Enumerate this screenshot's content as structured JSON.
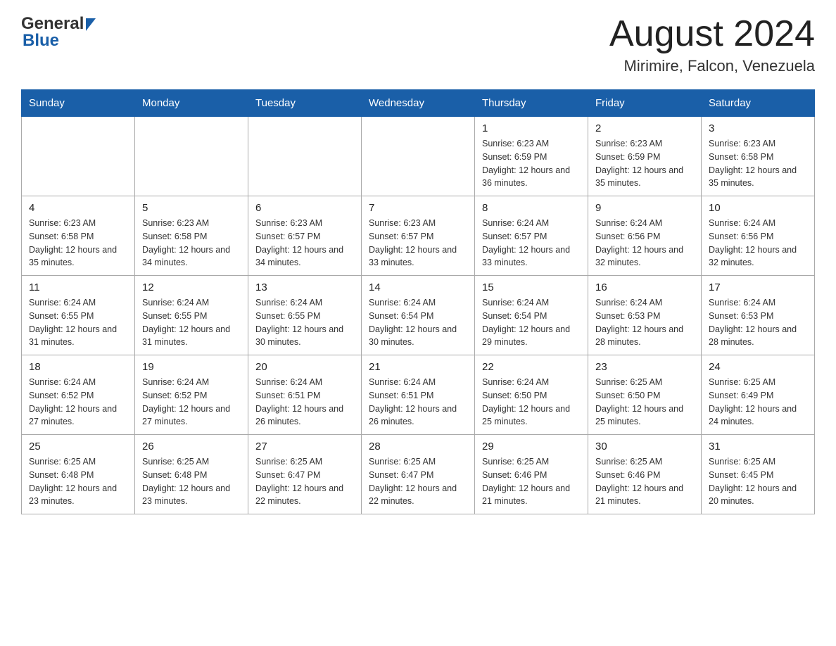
{
  "header": {
    "logo_general": "General",
    "logo_blue": "Blue",
    "title": "August 2024",
    "subtitle": "Mirimire, Falcon, Venezuela"
  },
  "calendar": {
    "days_of_week": [
      "Sunday",
      "Monday",
      "Tuesday",
      "Wednesday",
      "Thursday",
      "Friday",
      "Saturday"
    ],
    "weeks": [
      [
        {
          "day": "",
          "info": ""
        },
        {
          "day": "",
          "info": ""
        },
        {
          "day": "",
          "info": ""
        },
        {
          "day": "",
          "info": ""
        },
        {
          "day": "1",
          "info": "Sunrise: 6:23 AM\nSunset: 6:59 PM\nDaylight: 12 hours\nand 36 minutes."
        },
        {
          "day": "2",
          "info": "Sunrise: 6:23 AM\nSunset: 6:59 PM\nDaylight: 12 hours\nand 35 minutes."
        },
        {
          "day": "3",
          "info": "Sunrise: 6:23 AM\nSunset: 6:58 PM\nDaylight: 12 hours\nand 35 minutes."
        }
      ],
      [
        {
          "day": "4",
          "info": "Sunrise: 6:23 AM\nSunset: 6:58 PM\nDaylight: 12 hours\nand 35 minutes."
        },
        {
          "day": "5",
          "info": "Sunrise: 6:23 AM\nSunset: 6:58 PM\nDaylight: 12 hours\nand 34 minutes."
        },
        {
          "day": "6",
          "info": "Sunrise: 6:23 AM\nSunset: 6:57 PM\nDaylight: 12 hours\nand 34 minutes."
        },
        {
          "day": "7",
          "info": "Sunrise: 6:23 AM\nSunset: 6:57 PM\nDaylight: 12 hours\nand 33 minutes."
        },
        {
          "day": "8",
          "info": "Sunrise: 6:24 AM\nSunset: 6:57 PM\nDaylight: 12 hours\nand 33 minutes."
        },
        {
          "day": "9",
          "info": "Sunrise: 6:24 AM\nSunset: 6:56 PM\nDaylight: 12 hours\nand 32 minutes."
        },
        {
          "day": "10",
          "info": "Sunrise: 6:24 AM\nSunset: 6:56 PM\nDaylight: 12 hours\nand 32 minutes."
        }
      ],
      [
        {
          "day": "11",
          "info": "Sunrise: 6:24 AM\nSunset: 6:55 PM\nDaylight: 12 hours\nand 31 minutes."
        },
        {
          "day": "12",
          "info": "Sunrise: 6:24 AM\nSunset: 6:55 PM\nDaylight: 12 hours\nand 31 minutes."
        },
        {
          "day": "13",
          "info": "Sunrise: 6:24 AM\nSunset: 6:55 PM\nDaylight: 12 hours\nand 30 minutes."
        },
        {
          "day": "14",
          "info": "Sunrise: 6:24 AM\nSunset: 6:54 PM\nDaylight: 12 hours\nand 30 minutes."
        },
        {
          "day": "15",
          "info": "Sunrise: 6:24 AM\nSunset: 6:54 PM\nDaylight: 12 hours\nand 29 minutes."
        },
        {
          "day": "16",
          "info": "Sunrise: 6:24 AM\nSunset: 6:53 PM\nDaylight: 12 hours\nand 28 minutes."
        },
        {
          "day": "17",
          "info": "Sunrise: 6:24 AM\nSunset: 6:53 PM\nDaylight: 12 hours\nand 28 minutes."
        }
      ],
      [
        {
          "day": "18",
          "info": "Sunrise: 6:24 AM\nSunset: 6:52 PM\nDaylight: 12 hours\nand 27 minutes."
        },
        {
          "day": "19",
          "info": "Sunrise: 6:24 AM\nSunset: 6:52 PM\nDaylight: 12 hours\nand 27 minutes."
        },
        {
          "day": "20",
          "info": "Sunrise: 6:24 AM\nSunset: 6:51 PM\nDaylight: 12 hours\nand 26 minutes."
        },
        {
          "day": "21",
          "info": "Sunrise: 6:24 AM\nSunset: 6:51 PM\nDaylight: 12 hours\nand 26 minutes."
        },
        {
          "day": "22",
          "info": "Sunrise: 6:24 AM\nSunset: 6:50 PM\nDaylight: 12 hours\nand 25 minutes."
        },
        {
          "day": "23",
          "info": "Sunrise: 6:25 AM\nSunset: 6:50 PM\nDaylight: 12 hours\nand 25 minutes."
        },
        {
          "day": "24",
          "info": "Sunrise: 6:25 AM\nSunset: 6:49 PM\nDaylight: 12 hours\nand 24 minutes."
        }
      ],
      [
        {
          "day": "25",
          "info": "Sunrise: 6:25 AM\nSunset: 6:48 PM\nDaylight: 12 hours\nand 23 minutes."
        },
        {
          "day": "26",
          "info": "Sunrise: 6:25 AM\nSunset: 6:48 PM\nDaylight: 12 hours\nand 23 minutes."
        },
        {
          "day": "27",
          "info": "Sunrise: 6:25 AM\nSunset: 6:47 PM\nDaylight: 12 hours\nand 22 minutes."
        },
        {
          "day": "28",
          "info": "Sunrise: 6:25 AM\nSunset: 6:47 PM\nDaylight: 12 hours\nand 22 minutes."
        },
        {
          "day": "29",
          "info": "Sunrise: 6:25 AM\nSunset: 6:46 PM\nDaylight: 12 hours\nand 21 minutes."
        },
        {
          "day": "30",
          "info": "Sunrise: 6:25 AM\nSunset: 6:46 PM\nDaylight: 12 hours\nand 21 minutes."
        },
        {
          "day": "31",
          "info": "Sunrise: 6:25 AM\nSunset: 6:45 PM\nDaylight: 12 hours\nand 20 minutes."
        }
      ]
    ]
  }
}
